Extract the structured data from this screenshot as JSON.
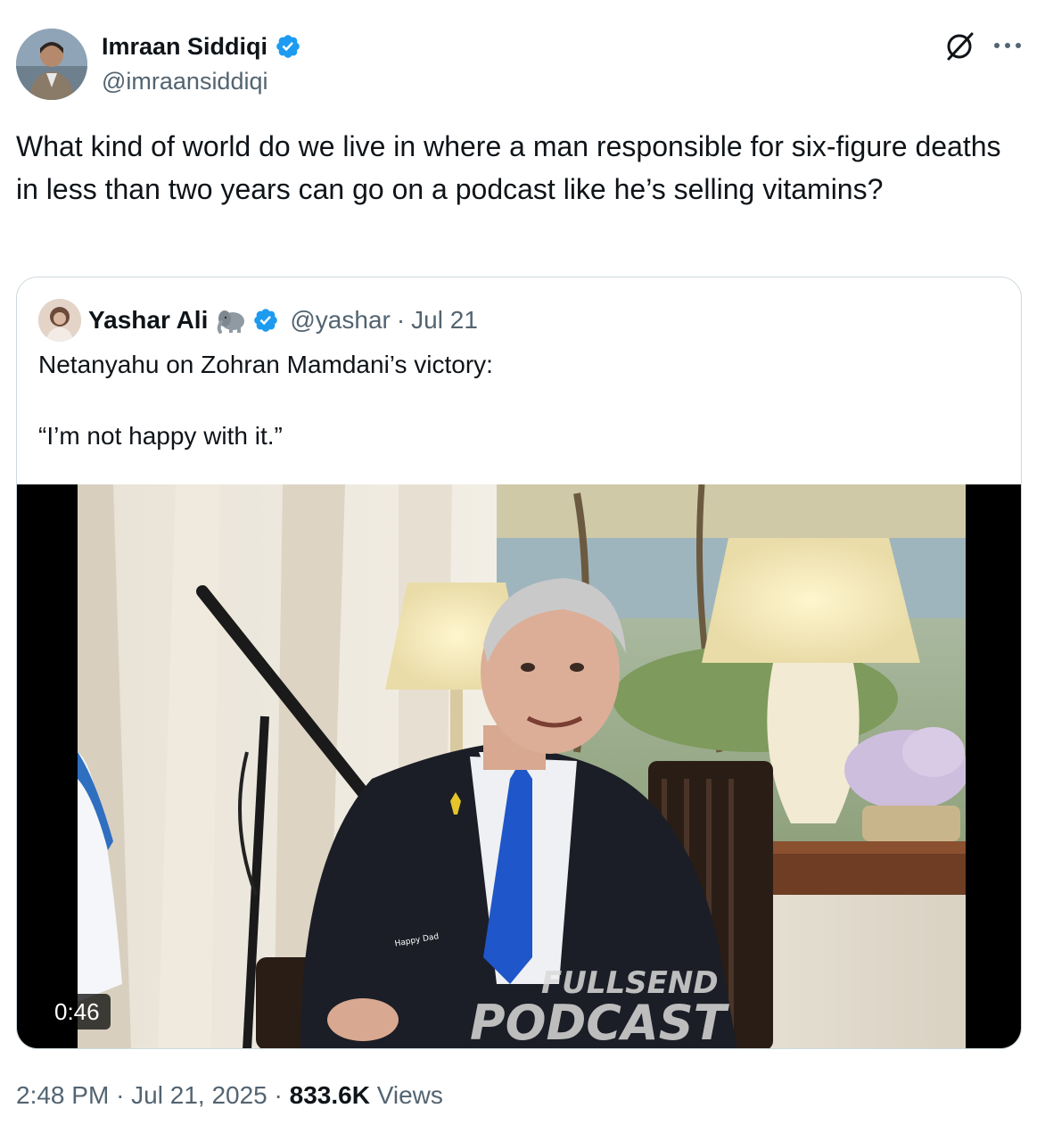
{
  "author": {
    "name": "Imraan Siddiqi",
    "handle": "@imraansiddiqi"
  },
  "tweet": {
    "text": "What kind of world do we live in where a man responsible for six-figure deaths in less than two years can go on a podcast like he’s selling vitamins?"
  },
  "quoted": {
    "name": "Yashar Ali",
    "emoji": "elephant-icon",
    "handle": "@yashar",
    "sep": "·",
    "date": "Jul 21",
    "line1": "Netanyahu on Zohran Mamdani’s victory:",
    "line2": "“I’m not happy with it.”",
    "video": {
      "duration": "0:46",
      "watermark_line1": "FULLSEND",
      "watermark_line2": "PODCAST",
      "mic_flag": "Happy Dad"
    }
  },
  "footer": {
    "time": "2:48 PM",
    "sep1": "·",
    "date": "Jul 21, 2025",
    "sep2": "·",
    "views": "833.6K",
    "views_label": "Views"
  },
  "colors": {
    "text": "#0f1419",
    "secondary": "#536471",
    "verified": "#1d9bf0",
    "border": "#cfd9de"
  },
  "icons": [
    "verified-badge-icon",
    "grok-icon",
    "more-icon",
    "elephant-icon"
  ]
}
